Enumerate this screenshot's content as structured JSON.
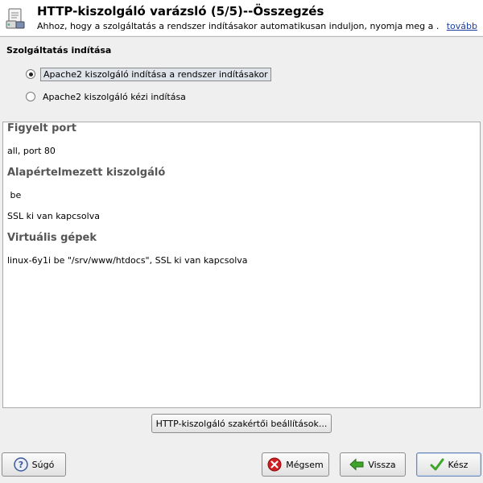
{
  "header": {
    "title": "HTTP-kiszolgáló varázsló (5/5)--Összegzés",
    "description": "Ahhoz, hogy a szolgáltatás a rendszer indításakor automatikusan induljon, nyomja meg a ...",
    "more_link": "tovább",
    "icon": "server-wizard-icon"
  },
  "service_start": {
    "label": "Szolgáltatás indítása",
    "options": [
      {
        "label": "Apache2 kiszolgáló indítása a rendszer indításakor",
        "checked": true
      },
      {
        "label": "Apache2 kiszolgáló kézi indítása",
        "checked": false
      }
    ]
  },
  "summary": {
    "sections": [
      {
        "heading": "Figyelt port",
        "lines": [
          "all, port 80"
        ]
      },
      {
        "heading": "Alapértelmezett kiszolgáló",
        "lines": [
          " be",
          "SSL ki van kapcsolva"
        ]
      },
      {
        "heading": "Virtuális gépek",
        "lines": [
          "linux-6y1i be \"/srv/www/htdocs\", SSL ki van kapcsolva"
        ]
      }
    ]
  },
  "expert_button": "HTTP-kiszolgáló szakértői beállítások...",
  "footer": {
    "help": "Súgó",
    "cancel": "Mégsem",
    "back": "Vissza",
    "finish": "Kész"
  },
  "colors": {
    "link": "#1a3ea3",
    "heading": "#555555",
    "cancel_red": "#d11e1e",
    "ok_green": "#3fa52a"
  }
}
